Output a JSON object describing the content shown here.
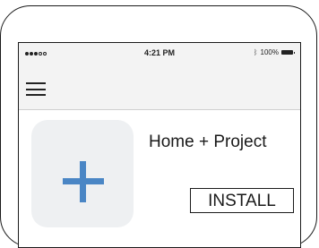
{
  "status_bar": {
    "time": "4:21 PM",
    "battery": "100%",
    "signal_dots_filled": 3,
    "signal_dots_total": 5,
    "icons": [
      "signal-dots-icon",
      "bluetooth-icon",
      "battery-icon"
    ]
  },
  "nav": {
    "menu_icon": "hamburger-menu-icon"
  },
  "app": {
    "title": "Home + Project",
    "icon": "plus-icon",
    "install_label": "INSTALL"
  },
  "colors": {
    "accent": "#4a86c5",
    "icon_background": "#eef0f2",
    "bar_background": "#f3f3f3",
    "outline": "#1a1a1a"
  }
}
